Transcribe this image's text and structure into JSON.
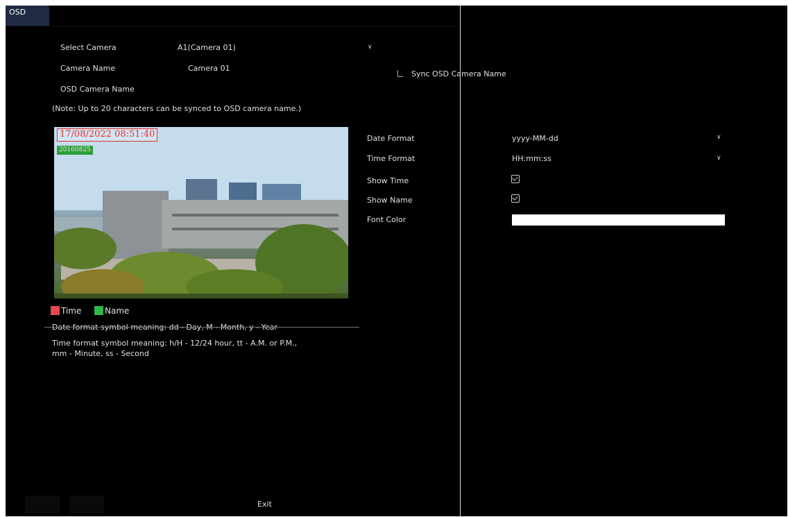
{
  "tab": {
    "label": "OSD"
  },
  "form": {
    "select_camera_label": "Select Camera",
    "select_camera_value": "A1(Camera 01)",
    "camera_name_label": "Camera Name",
    "camera_name_value": "Camera 01",
    "sync_label": "Sync OSD Camera Name",
    "osd_camera_name_label": "OSD Camera Name",
    "note": "(Note: Up to 20 characters can be synced to OSD camera name.)"
  },
  "preview": {
    "timestamp": "17/08/2022 08:51:40",
    "name_overlay": "20160825"
  },
  "legend": [
    {
      "label": "Time",
      "color": "#e5484d"
    },
    {
      "label": "Name",
      "color": "#2fb84a"
    }
  ],
  "help": {
    "date_symbols": "Date format symbol meaning: dd - Day, M - Month, y - Year",
    "time_symbols_1": "Time format symbol meaning: h/H - 12/24 hour, tt - A.M. or P.M.,",
    "time_symbols_2": "mm - Minute, ss - Second"
  },
  "settings": {
    "date_format_label": "Date Format",
    "date_format_value": "yyyy-MM-dd",
    "time_format_label": "Time Format",
    "time_format_value": "HH:mm:ss",
    "show_time_label": "Show Time",
    "show_name_label": "Show Name",
    "font_color_label": "Font Color",
    "font_color_value": "#ffffff",
    "show_time_checked": true,
    "show_name_checked": true
  },
  "footer": {
    "exit_label": "Exit"
  }
}
